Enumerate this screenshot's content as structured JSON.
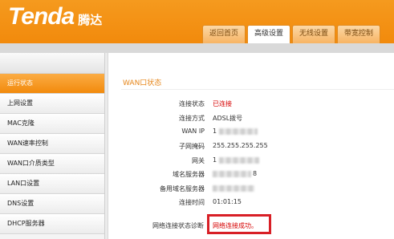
{
  "brand": {
    "logo": "Tenda",
    "logo_cn": "腾达"
  },
  "tabs": [
    {
      "label": "返回首页"
    },
    {
      "label": "高级设置"
    },
    {
      "label": "无线设置"
    },
    {
      "label": "带宽控制"
    }
  ],
  "sidebar": {
    "items": [
      {
        "label": "运行状态"
      },
      {
        "label": "上网设置"
      },
      {
        "label": "MAC克隆"
      },
      {
        "label": "WAN速率控制"
      },
      {
        "label": "WAN口介质类型"
      },
      {
        "label": "LAN口设置"
      },
      {
        "label": "DNS设置"
      },
      {
        "label": "DHCP服务器"
      }
    ]
  },
  "wan": {
    "title": "WAN口状态",
    "rows": [
      {
        "label": "连接状态",
        "value": "已连接"
      },
      {
        "label": "连接方式",
        "value": "ADSL拨号"
      },
      {
        "label": "WAN IP",
        "value": "1"
      },
      {
        "label": "子网掩码",
        "value": "255.255.255.255"
      },
      {
        "label": "网关",
        "value": "1"
      },
      {
        "label": "域名服务器",
        "value": "8"
      },
      {
        "label": "备用域名服务器",
        "value": ""
      },
      {
        "label": "连接时间",
        "value": "01:01:15"
      }
    ],
    "diagnosis": {
      "label": "网络连接状态诊断",
      "value": "网络连接成功。"
    }
  },
  "colors": {
    "brand_orange": "#f28a0c",
    "status_red": "#d60000",
    "highlight_box": "#d81f26"
  }
}
